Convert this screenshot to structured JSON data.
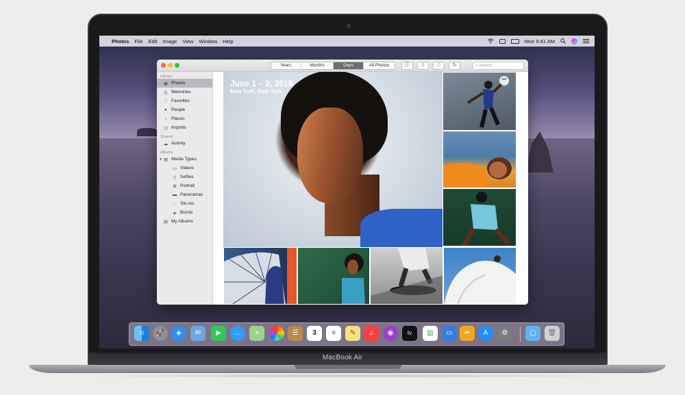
{
  "device": {
    "brand_label": "MacBook Air"
  },
  "menubar": {
    "apple_glyph": "",
    "app_name": "Photos",
    "items": [
      "File",
      "Edit",
      "Image",
      "View",
      "Window",
      "Help"
    ],
    "clock": "Mon 9:41 AM",
    "status_icons": [
      "wifi-icon",
      "airplay-icon",
      "battery-icon",
      "search-icon",
      "siri-icon",
      "control-center-icon"
    ]
  },
  "window": {
    "view_tabs": [
      {
        "label": "Years",
        "active": false
      },
      {
        "label": "Months",
        "active": false
      },
      {
        "label": "Days",
        "active": true
      },
      {
        "label": "All Photos",
        "active": false
      }
    ],
    "toolbar_icons": [
      "info-icon",
      "share-icon",
      "heart-icon",
      "rotate-icon"
    ],
    "search_placeholder": "Search"
  },
  "sidebar": {
    "sections": {
      "library": "Library",
      "shared": "Shared",
      "albums": "Albums"
    },
    "library_items": [
      {
        "label": "Photos",
        "icon": "photos-icon",
        "selected": true
      },
      {
        "label": "Memories",
        "icon": "memories-icon"
      },
      {
        "label": "Favorites",
        "icon": "heart-icon"
      },
      {
        "label": "People",
        "icon": "person-icon"
      },
      {
        "label": "Places",
        "icon": "pin-icon"
      },
      {
        "label": "Imports",
        "icon": "imports-icon"
      }
    ],
    "shared_items": [
      {
        "label": "Activity",
        "icon": "cloud-icon"
      }
    ],
    "album_items": [
      {
        "label": "Media Types",
        "icon": "folder-icon",
        "disclosure": true
      },
      {
        "label": "Videos",
        "icon": "video-icon",
        "sub": true
      },
      {
        "label": "Selfies",
        "icon": "selfie-icon",
        "sub": true
      },
      {
        "label": "Portrait",
        "icon": "portrait-icon",
        "sub": true
      },
      {
        "label": "Panoramas",
        "icon": "panorama-icon",
        "sub": true
      },
      {
        "label": "Slo-mo",
        "icon": "slomo-icon",
        "sub": true
      },
      {
        "label": "Bursts",
        "icon": "bursts-icon",
        "sub": true
      },
      {
        "label": "My Albums",
        "icon": "albums-icon"
      }
    ]
  },
  "main": {
    "day_title": "June 1 – 2, 2019",
    "day_location": "New York, New York",
    "more_label": "•••"
  },
  "dock": {
    "apps": [
      "Finder",
      "Launchpad",
      "Safari",
      "Mail",
      "FaceTime",
      "Messages",
      "Maps",
      "Photos",
      "Contacts",
      "Calendar",
      "Reminders",
      "Notes",
      "Music",
      "Podcasts",
      "TV",
      "Numbers",
      "Keynote",
      "Pages",
      "App Store",
      "System Preferences",
      "Downloads",
      "Trash"
    ],
    "calendar_day": "3",
    "tv_label": "tv"
  }
}
